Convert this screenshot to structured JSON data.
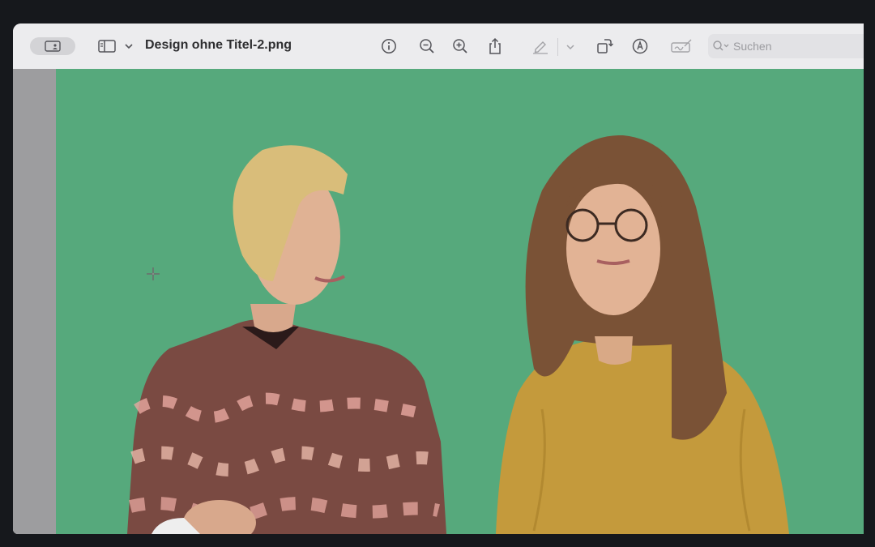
{
  "window": {
    "title": "Design ohne Titel-2.png"
  },
  "search": {
    "placeholder": "Suchen"
  },
  "colors": {
    "canvas_background": "#56a97c",
    "toolbar": "#ececee",
    "sidebar": "#9d9d9f"
  },
  "toolbar_icons": [
    "sidebar-icon",
    "chevron-down-icon",
    "info-icon",
    "zoom-out-icon",
    "zoom-in-icon",
    "share-icon",
    "markup-pen-icon",
    "chevron-down-icon",
    "rotate-icon",
    "annotate-icon",
    "signature-icon",
    "search-icon"
  ]
}
